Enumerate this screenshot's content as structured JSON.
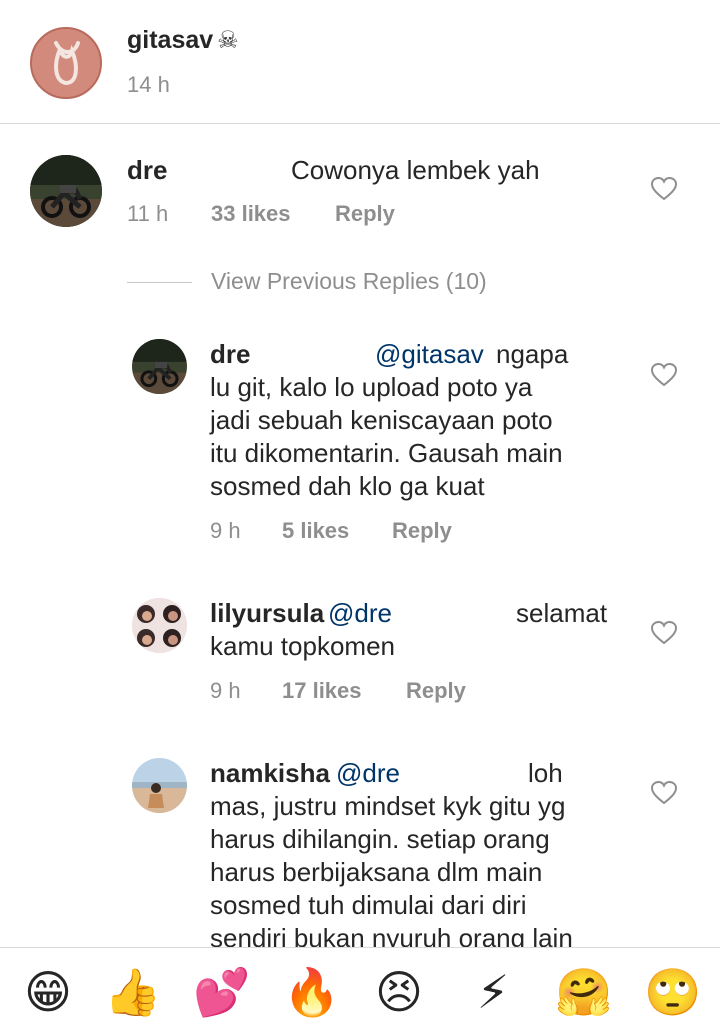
{
  "caption": {
    "username": "gitasav",
    "user_emoji": "☠",
    "time": "14 h"
  },
  "comments": [
    {
      "username": "dre",
      "text": "Cowonya lembek yah",
      "time": "11 h",
      "likes": "33 likes",
      "reply": "Reply"
    }
  ],
  "view_previous": "View Previous Replies (10)",
  "replies": [
    {
      "username": "dre",
      "mention": "@gitasav",
      "text_first": "ngapa",
      "text_lines": [
        "lu git, kalo lo upload poto ya",
        "jadi sebuah keniscayaan poto",
        "itu dikomentarin. Gausah main",
        "sosmed dah klo ga kuat"
      ],
      "time": "9 h",
      "likes": "5 likes",
      "reply": "Reply"
    },
    {
      "username": "lilyursula",
      "mention": "@dre",
      "text_first": "selamat",
      "text_lines": [
        "kamu topkomen"
      ],
      "time": "9 h",
      "likes": "17 likes",
      "reply": "Reply"
    },
    {
      "username": "namkisha",
      "mention": "@dre",
      "text_first": "loh",
      "text_lines": [
        "mas, justru mindset kyk gitu yg",
        "harus dihilangin. setiap orang",
        "harus berbijaksana dlm main",
        "sosmed tuh dimulai dari diri",
        "sendiri bukan nyuruh orang lain"
      ]
    }
  ],
  "emoji_bar": [
    {
      "icon": "laughing-emoji",
      "glyph": "😁"
    },
    {
      "icon": "thumbs-up-emoji",
      "glyph": "👍"
    },
    {
      "icon": "hearts-emoji",
      "glyph": "💕"
    },
    {
      "icon": "fire-emoji",
      "glyph": "🔥"
    },
    {
      "icon": "angry-emoji",
      "glyph": "😣"
    },
    {
      "icon": "lightning-emoji",
      "glyph": "⚡"
    },
    {
      "icon": "hugging-emoji",
      "glyph": "🤗"
    },
    {
      "icon": "eye-roll-emoji",
      "glyph": "🙄"
    }
  ],
  "colors": {
    "text": "#262626",
    "secondary": "#8e8e8e",
    "mention": "#003569",
    "divider": "#dbdbdb"
  }
}
